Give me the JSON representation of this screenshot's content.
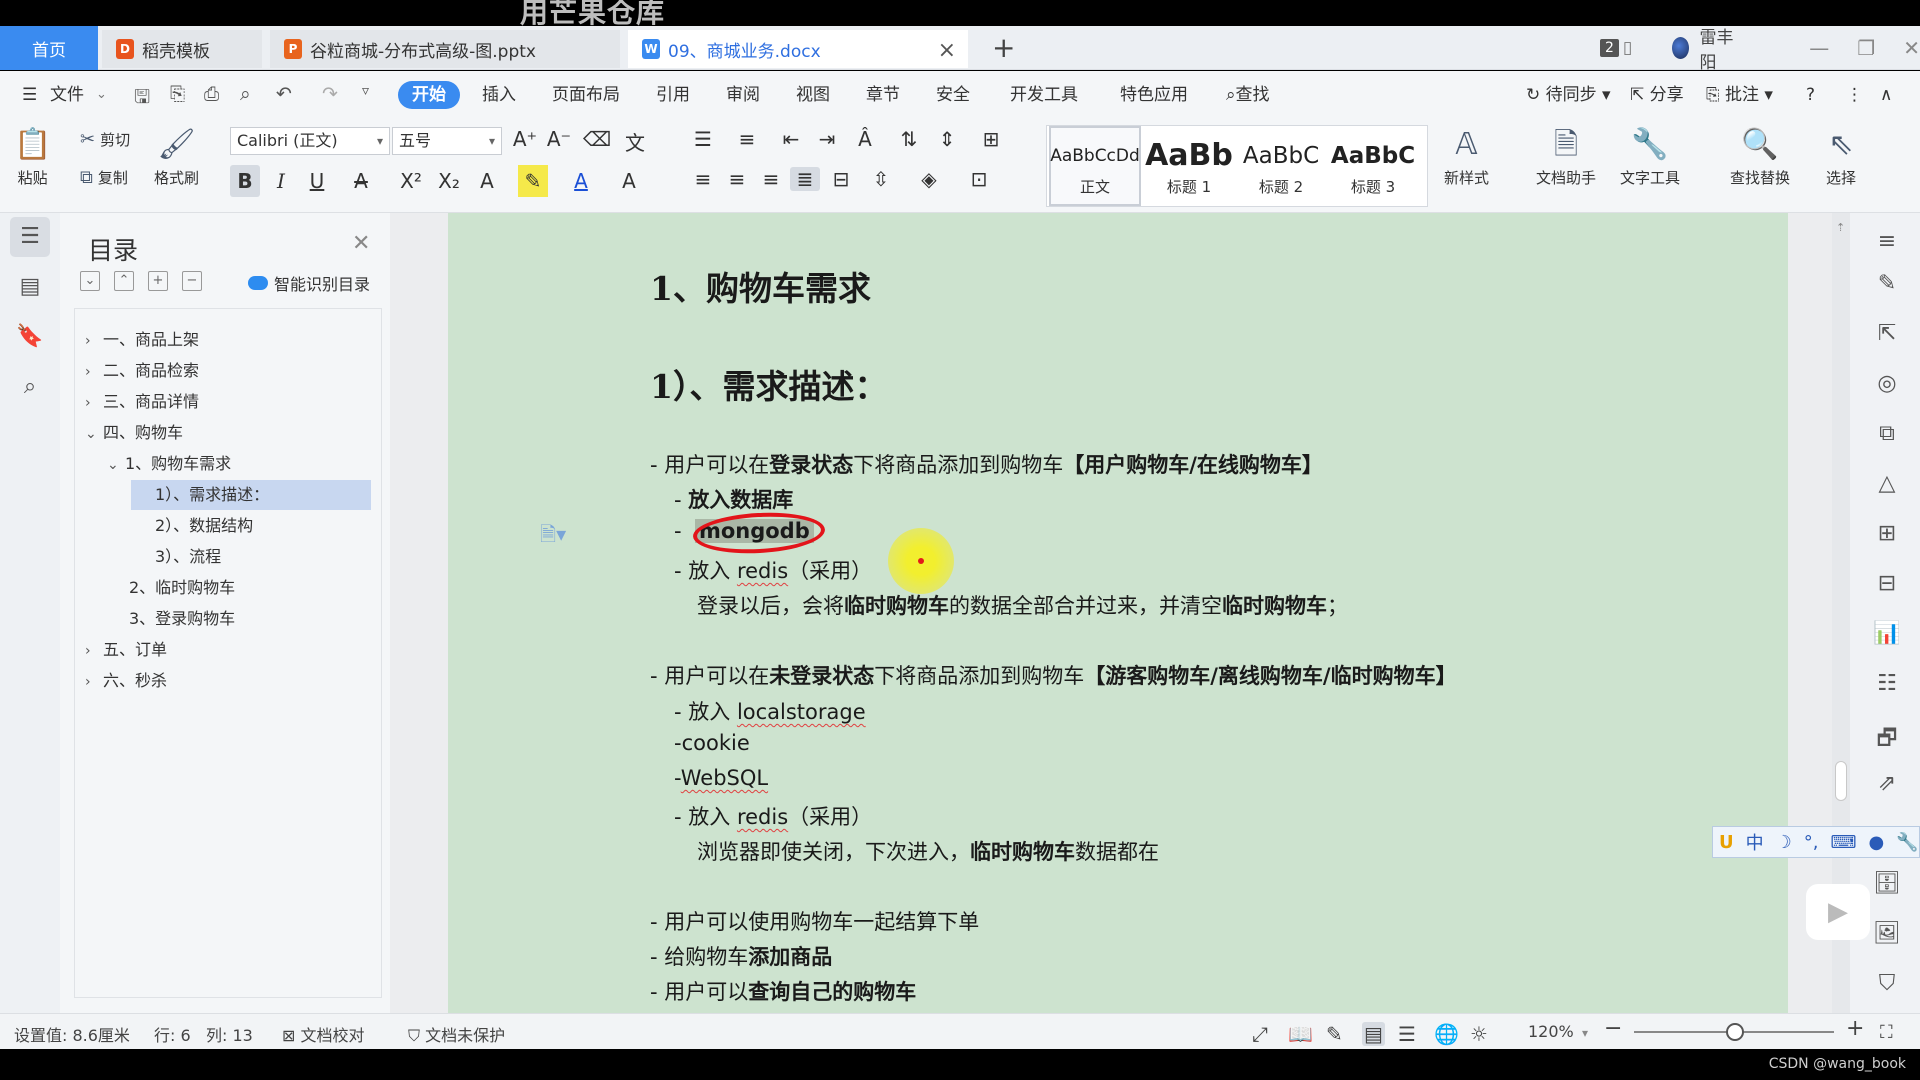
{
  "watermark_top": "用芒果仓库",
  "tabs": {
    "home": "首页",
    "tab1": "稻壳模板",
    "tab2": "谷粒商城-分布式高级-图.pptx",
    "tab3": "09、商城业务.docx",
    "page_count": "2",
    "user": "雷丰阳"
  },
  "menu": {
    "file": "文件",
    "start": "开始",
    "insert": "插入",
    "layout": "页面布局",
    "reference": "引用",
    "review": "审阅",
    "view": "视图",
    "chapter": "章节",
    "security": "安全",
    "devtools": "开发工具",
    "features": "特色应用",
    "search": "查找",
    "sync": "待同步",
    "share": "分享",
    "comment": "批注"
  },
  "ribbon": {
    "paste": "粘贴",
    "cut": "剪切",
    "copy": "复制",
    "format_painter": "格式刷",
    "font_name": "Calibri (正文)",
    "font_size": "五号",
    "styles": [
      {
        "sample": "AaBbCcDd",
        "name": "正文"
      },
      {
        "sample": "AaBb",
        "name": "标题 1"
      },
      {
        "sample": "AaBbC",
        "name": "标题 2"
      },
      {
        "sample": "AaBbC",
        "name": "标题 3"
      }
    ],
    "new_style": "新样式",
    "doc_assistant": "文档助手",
    "text_tools": "文字工具",
    "find_replace": "查找替换",
    "select": "选择"
  },
  "toc": {
    "title": "目录",
    "smart": "智能识别目录",
    "items": [
      {
        "label": "一、商品上架",
        "arrow": "›"
      },
      {
        "label": "二、商品检索",
        "arrow": "›"
      },
      {
        "label": "三、商品详情",
        "arrow": "›"
      },
      {
        "label": "四、购物车",
        "arrow": "⌄"
      },
      {
        "label": "1、购物车需求",
        "arrow": "⌄"
      },
      {
        "label": "1）、需求描述：",
        "arrow": ""
      },
      {
        "label": "2）、数据结构",
        "arrow": ""
      },
      {
        "label": "3）、流程",
        "arrow": ""
      },
      {
        "label": "2、临时购物车",
        "arrow": ""
      },
      {
        "label": "3、登录购物车",
        "arrow": ""
      },
      {
        "label": "五、订单",
        "arrow": "›"
      },
      {
        "label": "六、秒杀",
        "arrow": "›"
      }
    ]
  },
  "doc": {
    "h1": "1、购物车需求",
    "h2": "1）、需求描述：",
    "l1_pre": "- 用户可以在",
    "l1_b1": "登录状态",
    "l1_mid": "下将商品添加到购物车",
    "l1_b2": "【用户购物车/在线购物车】",
    "l2_pre": "- ",
    "l2_b": "放入数据库",
    "l3_pre": "- ",
    "l3_b": "mongodb",
    "l4_pre": "- 放入 ",
    "l4_sq": "redis",
    "l4_post": "（采用）",
    "l5_pre": "登录以后，会将",
    "l5_b1": "临时购物车",
    "l5_mid": "的数据全部合并过来，并清空",
    "l5_b2": "临时购物车",
    "l5_post": "；",
    "m1_pre": "- 用户可以在",
    "m1_b1": "未登录状态",
    "m1_mid": "下将商品添加到购物车",
    "m1_b2": "【游客购物车/离线购物车/临时购物车】",
    "m2_pre": "- 放入 ",
    "m2_sq": "localstorage",
    "m3": "-cookie",
    "m4_pre": "-",
    "m4_sq": "WebSQL",
    "m5_pre": "- 放入 ",
    "m5_sq": "redis",
    "m5_post": "（采用）",
    "m6_pre": "浏览器即使关闭，下次进入，",
    "m6_b": "临时购物车",
    "m6_post": "数据都在",
    "n1": "- 用户可以使用购物车一起结算下单",
    "n2_pre": "- 给购物车",
    "n2_b": "添加商品",
    "n3_pre": "- 用户可以",
    "n3_b": "查询自己的购物车"
  },
  "ime": {
    "logo": "U",
    "lang": "中",
    "moon": "☽",
    "punct": "°,",
    "kbd": "⌨"
  },
  "status": {
    "setting": "设置值: 8.6厘米",
    "row": "行: 6",
    "col": "列: 13",
    "proofread": "文档校对",
    "protect": "文档未保护",
    "zoom": "120%"
  },
  "footer_watermark": "CSDN @wang_book",
  "colors": {
    "accent": "#3a8bf0",
    "page": "#cde3cf",
    "annotation_red": "#e3141a",
    "highlight_yellow": "#f2ef2e"
  }
}
